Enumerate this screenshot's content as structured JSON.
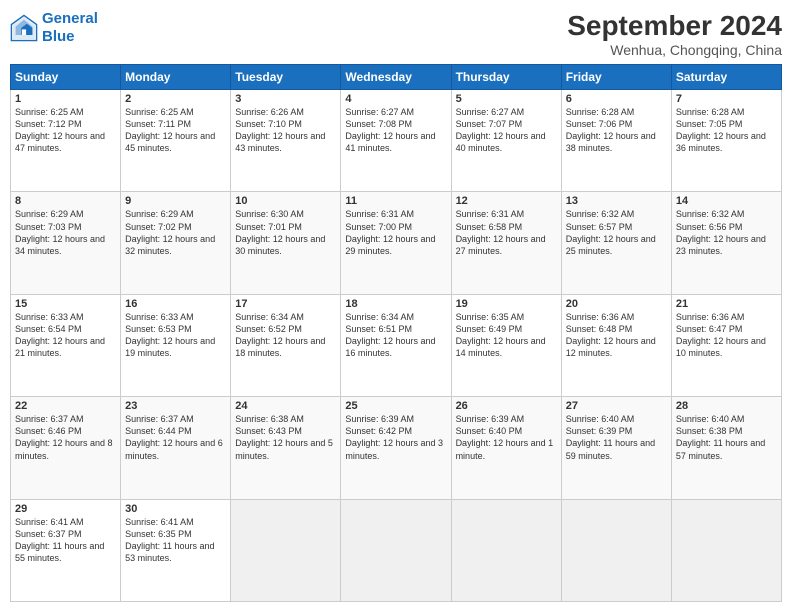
{
  "logo": {
    "line1": "General",
    "line2": "Blue"
  },
  "header": {
    "month": "September 2024",
    "location": "Wenhua, Chongqing, China"
  },
  "days": [
    "Sunday",
    "Monday",
    "Tuesday",
    "Wednesday",
    "Thursday",
    "Friday",
    "Saturday"
  ],
  "weeks": [
    [
      {
        "day": "1",
        "sunrise": "6:25 AM",
        "sunset": "7:12 PM",
        "daylight": "12 hours and 47 minutes."
      },
      {
        "day": "2",
        "sunrise": "6:25 AM",
        "sunset": "7:11 PM",
        "daylight": "12 hours and 45 minutes."
      },
      {
        "day": "3",
        "sunrise": "6:26 AM",
        "sunset": "7:10 PM",
        "daylight": "12 hours and 43 minutes."
      },
      {
        "day": "4",
        "sunrise": "6:27 AM",
        "sunset": "7:08 PM",
        "daylight": "12 hours and 41 minutes."
      },
      {
        "day": "5",
        "sunrise": "6:27 AM",
        "sunset": "7:07 PM",
        "daylight": "12 hours and 40 minutes."
      },
      {
        "day": "6",
        "sunrise": "6:28 AM",
        "sunset": "7:06 PM",
        "daylight": "12 hours and 38 minutes."
      },
      {
        "day": "7",
        "sunrise": "6:28 AM",
        "sunset": "7:05 PM",
        "daylight": "12 hours and 36 minutes."
      }
    ],
    [
      {
        "day": "8",
        "sunrise": "6:29 AM",
        "sunset": "7:03 PM",
        "daylight": "12 hours and 34 minutes."
      },
      {
        "day": "9",
        "sunrise": "6:29 AM",
        "sunset": "7:02 PM",
        "daylight": "12 hours and 32 minutes."
      },
      {
        "day": "10",
        "sunrise": "6:30 AM",
        "sunset": "7:01 PM",
        "daylight": "12 hours and 30 minutes."
      },
      {
        "day": "11",
        "sunrise": "6:31 AM",
        "sunset": "7:00 PM",
        "daylight": "12 hours and 29 minutes."
      },
      {
        "day": "12",
        "sunrise": "6:31 AM",
        "sunset": "6:58 PM",
        "daylight": "12 hours and 27 minutes."
      },
      {
        "day": "13",
        "sunrise": "6:32 AM",
        "sunset": "6:57 PM",
        "daylight": "12 hours and 25 minutes."
      },
      {
        "day": "14",
        "sunrise": "6:32 AM",
        "sunset": "6:56 PM",
        "daylight": "12 hours and 23 minutes."
      }
    ],
    [
      {
        "day": "15",
        "sunrise": "6:33 AM",
        "sunset": "6:54 PM",
        "daylight": "12 hours and 21 minutes."
      },
      {
        "day": "16",
        "sunrise": "6:33 AM",
        "sunset": "6:53 PM",
        "daylight": "12 hours and 19 minutes."
      },
      {
        "day": "17",
        "sunrise": "6:34 AM",
        "sunset": "6:52 PM",
        "daylight": "12 hours and 18 minutes."
      },
      {
        "day": "18",
        "sunrise": "6:34 AM",
        "sunset": "6:51 PM",
        "daylight": "12 hours and 16 minutes."
      },
      {
        "day": "19",
        "sunrise": "6:35 AM",
        "sunset": "6:49 PM",
        "daylight": "12 hours and 14 minutes."
      },
      {
        "day": "20",
        "sunrise": "6:36 AM",
        "sunset": "6:48 PM",
        "daylight": "12 hours and 12 minutes."
      },
      {
        "day": "21",
        "sunrise": "6:36 AM",
        "sunset": "6:47 PM",
        "daylight": "12 hours and 10 minutes."
      }
    ],
    [
      {
        "day": "22",
        "sunrise": "6:37 AM",
        "sunset": "6:46 PM",
        "daylight": "12 hours and 8 minutes."
      },
      {
        "day": "23",
        "sunrise": "6:37 AM",
        "sunset": "6:44 PM",
        "daylight": "12 hours and 6 minutes."
      },
      {
        "day": "24",
        "sunrise": "6:38 AM",
        "sunset": "6:43 PM",
        "daylight": "12 hours and 5 minutes."
      },
      {
        "day": "25",
        "sunrise": "6:39 AM",
        "sunset": "6:42 PM",
        "daylight": "12 hours and 3 minutes."
      },
      {
        "day": "26",
        "sunrise": "6:39 AM",
        "sunset": "6:40 PM",
        "daylight": "12 hours and 1 minute."
      },
      {
        "day": "27",
        "sunrise": "6:40 AM",
        "sunset": "6:39 PM",
        "daylight": "11 hours and 59 minutes."
      },
      {
        "day": "28",
        "sunrise": "6:40 AM",
        "sunset": "6:38 PM",
        "daylight": "11 hours and 57 minutes."
      }
    ],
    [
      {
        "day": "29",
        "sunrise": "6:41 AM",
        "sunset": "6:37 PM",
        "daylight": "11 hours and 55 minutes."
      },
      {
        "day": "30",
        "sunrise": "6:41 AM",
        "sunset": "6:35 PM",
        "daylight": "11 hours and 53 minutes."
      },
      null,
      null,
      null,
      null,
      null
    ]
  ]
}
